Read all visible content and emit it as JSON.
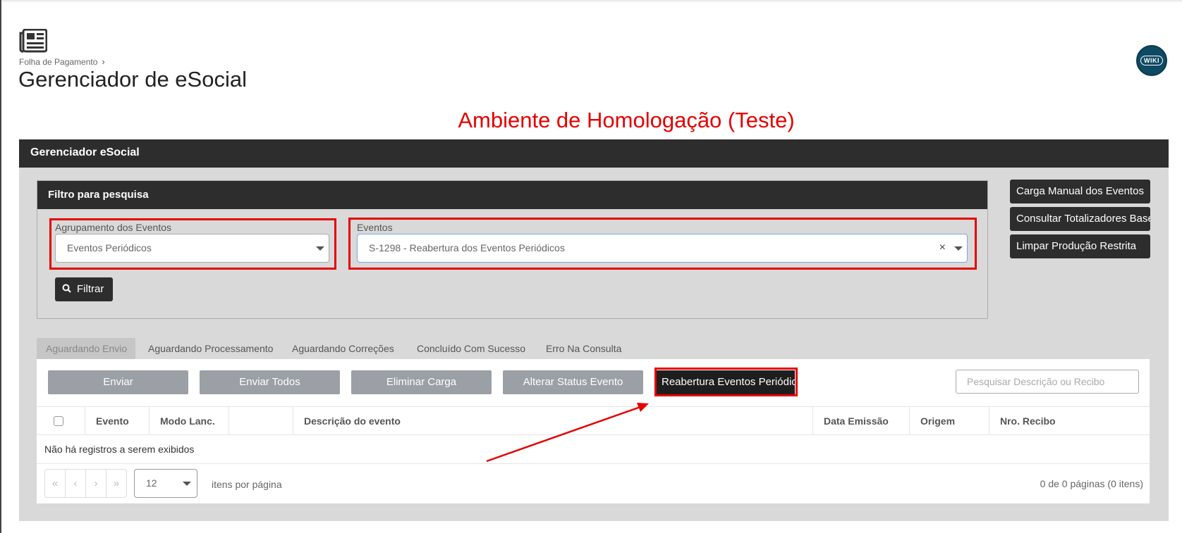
{
  "breadcrumb": {
    "parent": "Folha de Pagamento",
    "separator": "›"
  },
  "page": {
    "title": "Gerenciador de eSocial"
  },
  "wiki": {
    "label": "WIKI"
  },
  "environment": {
    "banner": "Ambiente de Homologação (Teste)"
  },
  "panel": {
    "title": "Gerenciador eSocial"
  },
  "filter": {
    "title": "Filtro para pesquisa",
    "grouping": {
      "label": "Agrupamento dos Eventos",
      "value": "Eventos Periódicos"
    },
    "events": {
      "label": "Eventos",
      "value": "S-1298 - Reabertura dos Eventos Periódicos",
      "clear": "×"
    },
    "filter_button": "Filtrar"
  },
  "side_buttons": {
    "manual_load": "Carga Manual dos Eventos",
    "consult_totals": "Consultar Totalizadores Base",
    "clear_restricted": "Limpar Produção Restrita"
  },
  "tabs": [
    {
      "label": "Aguardando Envio"
    },
    {
      "label": "Aguardando Processamento"
    },
    {
      "label": "Aguardando Correções"
    },
    {
      "label": "Concluído Com Sucesso"
    },
    {
      "label": "Erro Na Consulta"
    }
  ],
  "actions": {
    "send": "Enviar",
    "send_all": "Enviar Todos",
    "delete_load": "Eliminar Carga",
    "change_status": "Alterar Status Evento",
    "reopen_periodic": "Reabertura Eventos Periódicos"
  },
  "search": {
    "placeholder": "Pesquisar Descrição ou Recibo"
  },
  "grid": {
    "columns": [
      "Evento",
      "Modo Lanc.",
      "",
      "Descrição do evento",
      "Data Emissão",
      "Origem",
      "Nro. Recibo"
    ],
    "empty_message": "Não há registros a serem exibidos"
  },
  "pagination": {
    "first": "«",
    "prev": "‹",
    "next": "›",
    "last": "»",
    "page_size": "12",
    "per_page_label": "itens por página",
    "info": "0 de 0 páginas (0 itens)"
  },
  "colors": {
    "accent_red": "#e60000",
    "dark_header": "#2d2d2d",
    "wiki_blue": "#0e4a63"
  }
}
